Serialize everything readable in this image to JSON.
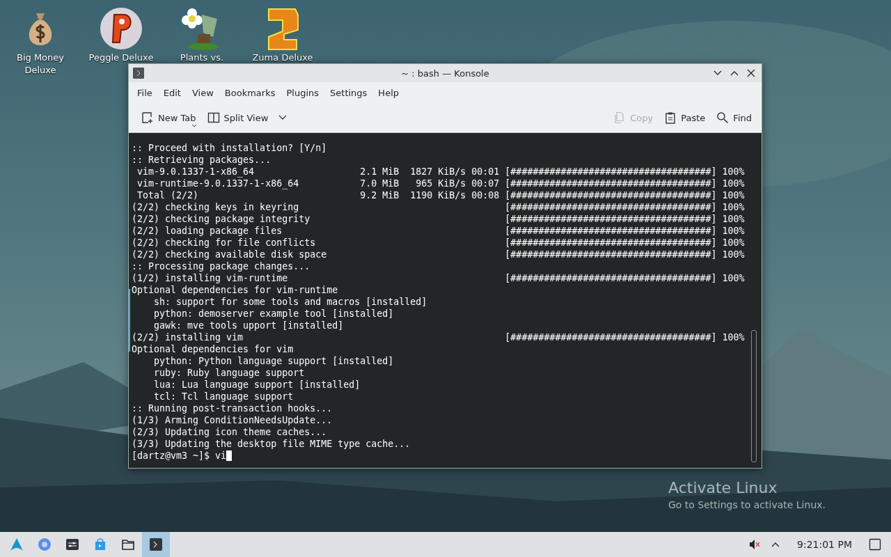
{
  "desktop": {
    "icons": [
      {
        "label": "Big Money Deluxe",
        "kind": "bag"
      },
      {
        "label": "Peggle Deluxe",
        "kind": "ball"
      },
      {
        "label": "Plants vs.",
        "kind": "flower"
      },
      {
        "label": "Zuma Deluxe",
        "kind": "block"
      }
    ]
  },
  "window": {
    "title": "~ : bash — Konsole",
    "menu": [
      "File",
      "Edit",
      "View",
      "Bookmarks",
      "Plugins",
      "Settings",
      "Help"
    ],
    "toolbar_left": [
      {
        "label": "New Tab",
        "kind": "new-tab",
        "disabled": false
      },
      {
        "label": "Split View",
        "kind": "split",
        "disabled": false
      }
    ],
    "toolbar_right": [
      {
        "label": "Copy",
        "kind": "copy",
        "disabled": true
      },
      {
        "label": "Paste",
        "kind": "paste",
        "disabled": false
      },
      {
        "label": "Find",
        "kind": "find",
        "disabled": false
      }
    ],
    "terminal": {
      "lines": [
        ":: Proceed with installation? [Y/n]",
        ":: Retrieving packages...",
        " vim-9.0.1337-1-x86_64                   2.1 MiB  1827 KiB/s 00:01 [####################################] 100%",
        " vim-runtime-9.0.1337-1-x86_64           7.0 MiB   965 KiB/s 00:07 [####################################] 100%",
        " Total (2/2)                             9.2 MiB  1190 KiB/s 00:08 [####################################] 100%",
        "(2/2) checking keys in keyring                                     [####################################] 100%",
        "(2/2) checking package integrity                                   [####################################] 100%",
        "(2/2) loading package files                                        [####################################] 100%",
        "(2/2) checking for file conflicts                                  [####################################] 100%",
        "(2/2) checking available disk space                                [####################################] 100%",
        ":: Processing package changes...",
        "(1/2) installing vim-runtime                                       [####################################] 100%",
        "Optional dependencies for vim-runtime",
        "    sh: support for some tools and macros [installed]",
        "    python: demoserver example tool [installed]",
        "    gawk: mve tools upport [installed]",
        "(2/2) installing vim                                               [####################################] 100%",
        "Optional dependencies for vim",
        "    python: Python language support [installed]",
        "    ruby: Ruby language support",
        "    lua: Lua language support [installed]",
        "    tcl: Tcl language support",
        ":: Running post-transaction hooks...",
        "(1/3) Arming ConditionNeedsUpdate...",
        "(2/3) Updating icon theme caches...",
        "(3/3) Updating the desktop file MIME type cache..."
      ],
      "prompt": "[dartz@vm3 ~]$ vi"
    }
  },
  "watermark": {
    "title": "Activate Linux",
    "subtitle": "Go to Settings to activate Linux."
  },
  "taskbar": {
    "tasks": [
      {
        "kind": "launcher",
        "selected": false
      },
      {
        "kind": "browser",
        "selected": false
      },
      {
        "kind": "settings",
        "selected": false
      },
      {
        "kind": "store",
        "selected": false
      },
      {
        "kind": "files",
        "selected": false
      },
      {
        "kind": "terminal",
        "selected": true
      }
    ],
    "clock": "9:21:01 PM"
  }
}
